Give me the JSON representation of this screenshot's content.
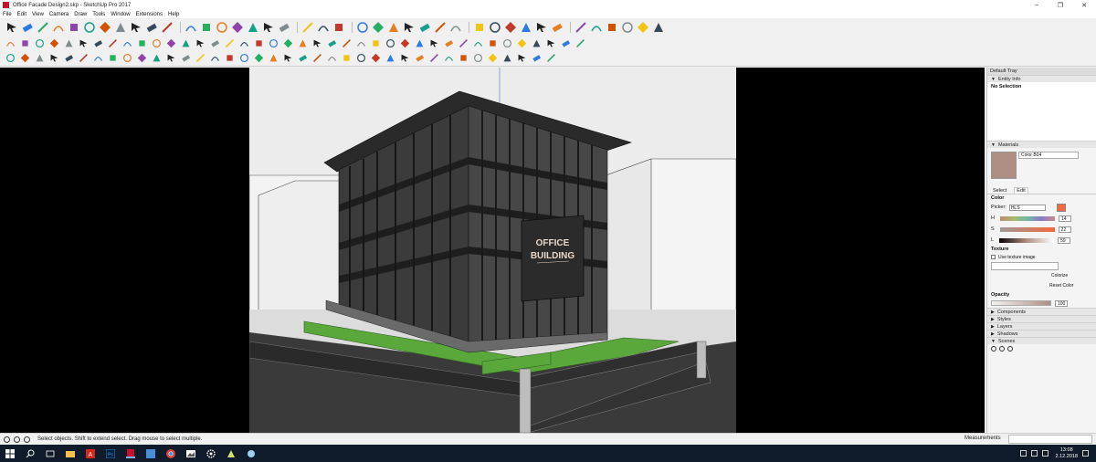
{
  "window": {
    "title": "Office Facade Design2.skp - SketchUp Pro 2017",
    "controls": [
      "minimize",
      "restore",
      "close"
    ]
  },
  "menu": [
    "File",
    "Edit",
    "View",
    "Camera",
    "Draw",
    "Tools",
    "Window",
    "Extensions",
    "Help"
  ],
  "toolbars": {
    "row1": [
      "select-icon",
      "eraser-icon",
      "pencil-icon",
      "arc-icon",
      "paint-bucket-icon",
      "push-pull-icon",
      "move-icon",
      "rotate-icon",
      "scale-icon",
      "tape-measure-icon",
      "text-icon",
      "orbit-icon",
      "pan-icon",
      "zoom-icon",
      "zoom-extents-icon",
      "3d-warehouse-icon",
      "extension-warehouse-icon",
      "layout-icon",
      "play-icon",
      "section-plane-icon",
      "settings-icon",
      "xray-icon",
      "back-edges-icon",
      "wireframe-icon",
      "hidden-line-icon",
      "shaded-icon",
      "textured-icon",
      "monochrome-icon",
      "iso-view-icon",
      "top-view-icon",
      "front-view-icon",
      "right-view-icon",
      "back-view-icon",
      "left-view-icon",
      "sandbox-icon",
      "sandbox-scratch-icon",
      "sandbox-smoove-icon",
      "sandbox-stamp-icon",
      "sandbox-drape-icon",
      "ruby-console-icon"
    ],
    "row2_count": 40,
    "row3_count": 38
  },
  "scene": {
    "sign_line1": "OFFICE",
    "sign_line2": "BUILDING"
  },
  "tray": {
    "title": "Default Tray",
    "entity_info": "Entity Info",
    "selection": "No Selection",
    "materials": "Materials",
    "material_name": "Color B04",
    "material_color": "#ae8e82",
    "tab_select": "Select",
    "tab_edit": "Edit",
    "color_label": "Color",
    "picker_label": "Picker:",
    "picker_value": "HLS",
    "current_color": "#f26a3d",
    "sliders": [
      {
        "label": "H",
        "value": "14"
      },
      {
        "label": "S",
        "value": "22"
      },
      {
        "label": "L",
        "value": "59"
      }
    ],
    "texture_label": "Texture",
    "use_texture": "Use texture image",
    "colorize": "Colorize",
    "reset_color": "Reset Color",
    "opacity_label": "Opacity",
    "opacity_value": "100",
    "sections": [
      "Components",
      "Styles",
      "Layers",
      "Shadows",
      "Scenes"
    ]
  },
  "status": {
    "message": "Select objects. Shift to extend select. Drag mouse to select multiple.",
    "measurements_label": "Measurements"
  },
  "taskbar": {
    "apps": [
      "windows-start-icon",
      "search-icon",
      "task-view-icon",
      "file-explorer-icon",
      "acrobat-icon",
      "photoshop-icon",
      "sketchup-icon",
      "calculator-icon",
      "chrome-icon",
      "photos-icon",
      "settings-icon",
      "media-icon",
      "app-icon"
    ],
    "time": "13:08",
    "date": "2.12.2018"
  }
}
